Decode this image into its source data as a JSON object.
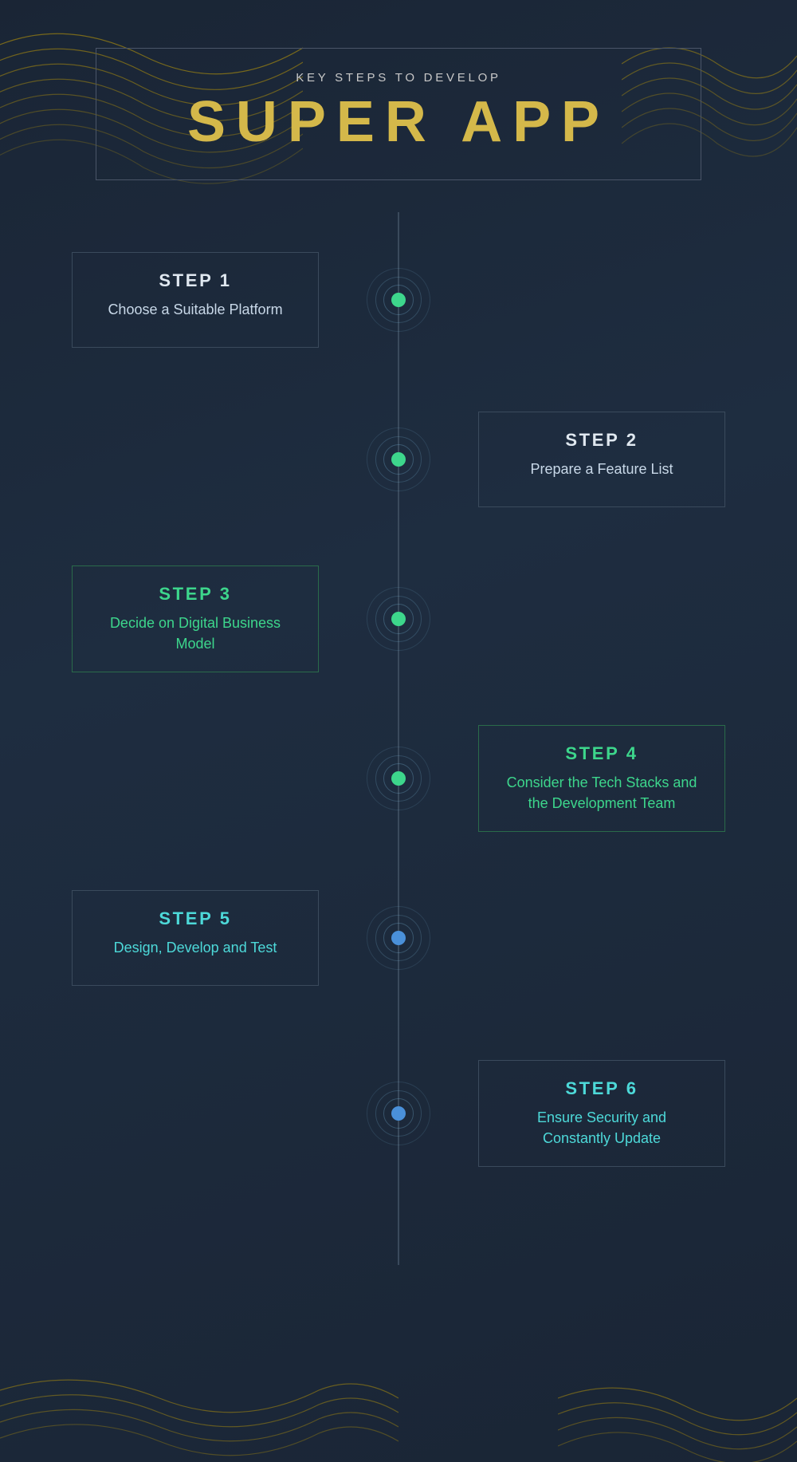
{
  "page": {
    "background": "#1e2a3a",
    "header": {
      "subtitle": "KEY STEPS TO DEVELOP",
      "title": "SUPER APP"
    },
    "steps": [
      {
        "id": 1,
        "number": "STEP 1",
        "description": "Choose a Suitable Platform",
        "side": "left",
        "color": "white",
        "node_color": "green",
        "border": "default"
      },
      {
        "id": 2,
        "number": "STEP 2",
        "description": "Prepare a Feature List",
        "side": "right",
        "color": "white",
        "node_color": "green",
        "border": "default"
      },
      {
        "id": 3,
        "number": "STEP 3",
        "description": "Decide on Digital Business Model",
        "side": "left",
        "color": "green",
        "node_color": "green",
        "border": "green"
      },
      {
        "id": 4,
        "number": "STEP 4",
        "description": "Consider the Tech Stacks and the Development Team",
        "side": "right",
        "color": "green",
        "node_color": "green",
        "border": "green"
      },
      {
        "id": 5,
        "number": "STEP 5",
        "description": "Design, Develop and Test",
        "side": "left",
        "color": "cyan",
        "node_color": "blue",
        "border": "default"
      },
      {
        "id": 6,
        "number": "STEP 6",
        "description": "Ensure Security and Constantly Update",
        "side": "right",
        "color": "cyan",
        "node_color": "blue",
        "border": "default"
      }
    ]
  }
}
